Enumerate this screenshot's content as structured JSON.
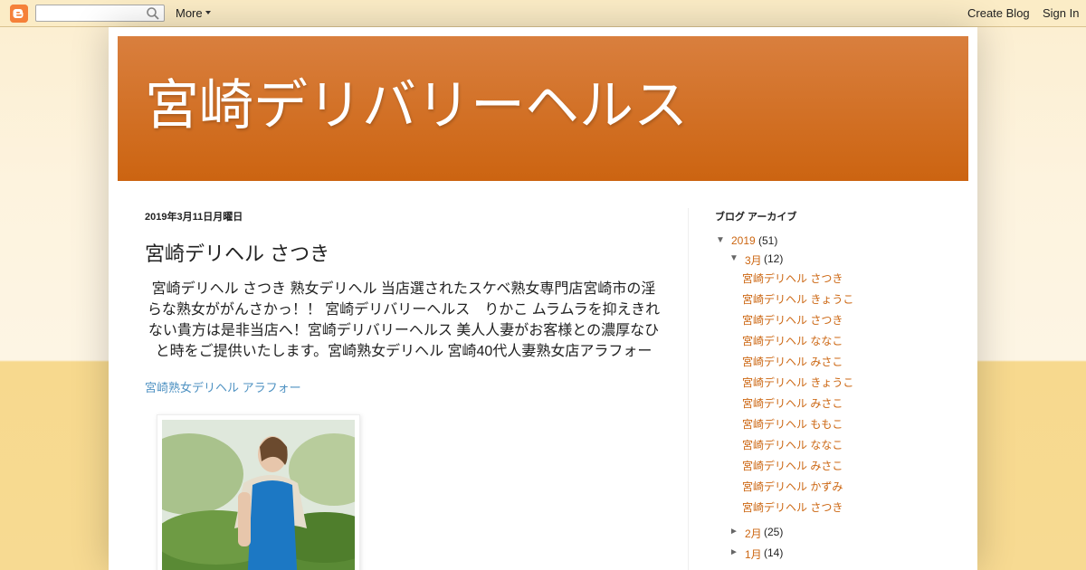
{
  "navbar": {
    "more_label": "More",
    "create_blog_label": "Create Blog",
    "sign_in_label": "Sign In",
    "search_value": ""
  },
  "blog": {
    "title": "宮崎デリバリーヘルス"
  },
  "post": {
    "date": "2019年3月11日月曜日",
    "title": "宮崎デリヘル さつき",
    "body_lines": [
      "宮崎デリヘル さつき 熟女デリヘル 当店選されたスケベ熟女専門店宮崎市の淫",
      "らな熟女ががんさかっ！！ 宮崎デリバリーヘルス　りかこ ムラムラを抑えきれ",
      "ない貴方は是非当店へ！宮崎デリバリーヘルス 美人人妻がお客様との濃厚なひ",
      "と時をご提供いたします。宮崎熟女デリヘル 宮崎40代人妻熟女店アラフォー"
    ],
    "link_text": "宮崎熟女デリヘル アラフォー"
  },
  "sidebar": {
    "archive_title": "ブログ アーカイブ",
    "year": {
      "label": "2019",
      "count": "(51)",
      "toggle": "▼"
    },
    "months": [
      {
        "label": "3月",
        "count": "(12)",
        "toggle": "▼"
      },
      {
        "label": "2月",
        "count": "(25)",
        "toggle": "►"
      },
      {
        "label": "1月",
        "count": "(14)",
        "toggle": "►"
      }
    ],
    "posts": [
      "宮崎デリヘル さつき",
      "宮崎デリヘル きょうこ",
      "宮崎デリヘル さつき",
      "宮崎デリヘル ななこ",
      "宮崎デリヘル みさこ",
      "宮崎デリヘル きょうこ",
      "宮崎デリヘル みさこ",
      "宮崎デリヘル ももこ",
      "宮崎デリヘル ななこ",
      "宮崎デリヘル みさこ",
      "宮崎デリヘル かずみ",
      "宮崎デリヘル さつき"
    ]
  },
  "colors": {
    "accent": "#cc6611",
    "header_top": "#d97f3e",
    "header_bottom": "#cc6411",
    "link_blue": "#4f92c2"
  }
}
